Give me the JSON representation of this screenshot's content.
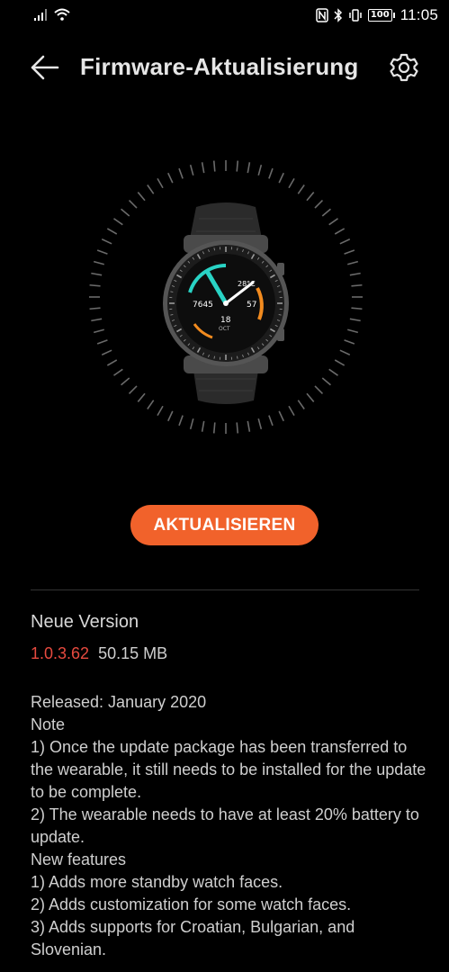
{
  "status_bar": {
    "time": "11:05",
    "battery": "100"
  },
  "app_bar": {
    "title": "Firmware-Aktualisierung"
  },
  "watch": {
    "temperature": "28°C",
    "steps": "7645",
    "heart_rate": "57",
    "day": "18",
    "month": "OCT"
  },
  "update_button": {
    "label": "AKTUALISIEREN",
    "color": "#f1622b"
  },
  "version": {
    "heading": "Neue Version",
    "number": "1.0.3.62",
    "number_color": "#e64a3f",
    "size": "50.15 MB"
  },
  "release_notes": {
    "lines": [
      "Released: January 2020",
      "Note",
      "1) Once the update package has been transferred to the wearable, it still needs to be installed for the update to be complete.",
      "2) The wearable needs to have at least 20% battery to update.",
      "New features",
      "1) Adds more standby watch faces.",
      "2) Adds customization for some watch faces.",
      "3) Adds supports for Croatian, Bulgarian, and Slovenian."
    ]
  },
  "icons": {
    "signal": "signal-icon",
    "wifi": "wifi-icon",
    "nfc": "nfc-icon",
    "bluetooth": "bluetooth-icon",
    "vibrate": "vibrate-icon",
    "battery": "battery-icon",
    "back": "arrow-left-icon",
    "settings": "gear-icon"
  }
}
